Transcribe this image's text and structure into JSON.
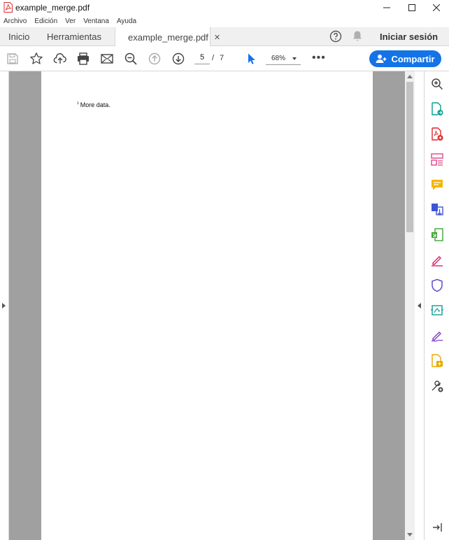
{
  "window": {
    "title": "example_merge.pdf"
  },
  "menu": {
    "items": [
      "Archivo",
      "Edición",
      "Ver",
      "Ventana",
      "Ayuda"
    ]
  },
  "tabs": {
    "home": "Inicio",
    "tools": "Herramientas",
    "document": "example_merge.pdf",
    "close_glyph": "✕"
  },
  "account": {
    "signin_label": "Iniciar sesión"
  },
  "toolbar": {
    "current_page": "5",
    "page_separator": "/",
    "total_pages": "7",
    "zoom": "68%",
    "more_glyph": "•••",
    "share_label": "Compartir"
  },
  "document": {
    "footnote_marker": "1",
    "footnote_text": "More data."
  },
  "colors": {
    "accent": "#1473e6",
    "page_background": "#a0a0a0"
  },
  "right_panel": {
    "tools": [
      "search-zoom-icon",
      "export-pdf-icon",
      "create-pdf-icon",
      "organize-pages-icon",
      "comment-icon",
      "combine-files-icon",
      "compress-icon",
      "fill-sign-icon",
      "protect-icon",
      "send-for-signature-icon",
      "request-signature-icon",
      "more-tools-icon",
      "customize-tools-icon",
      "collapse-panel-icon"
    ]
  }
}
